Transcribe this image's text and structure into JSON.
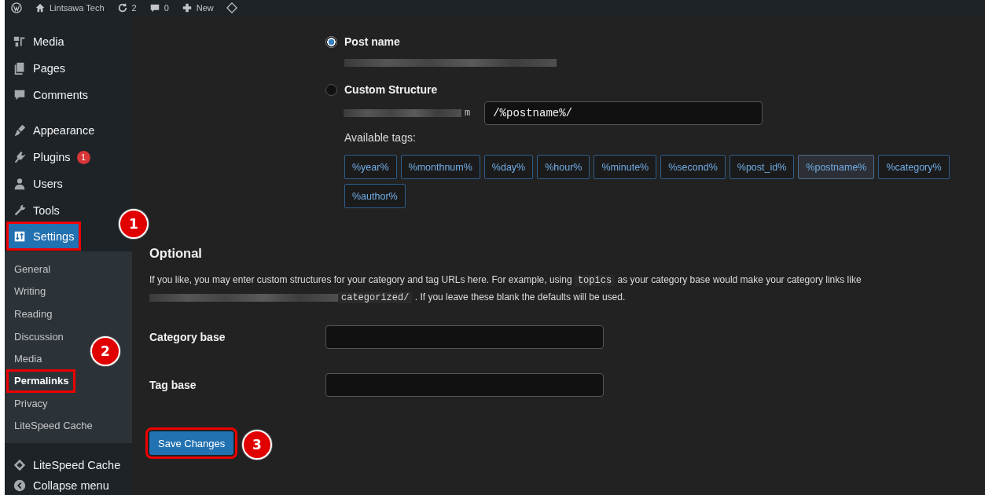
{
  "admin_bar": {
    "site": "Lintsawa Tech",
    "updates": "2",
    "comments": "0",
    "new": "New"
  },
  "sidebar": {
    "groups": [
      {
        "items": [
          {
            "label": "Media",
            "selected": false
          },
          {
            "label": "Pages",
            "selected": false
          },
          {
            "label": "Comments",
            "selected": false
          }
        ]
      },
      {
        "items": [
          {
            "label": "Appearance",
            "selected": false
          },
          {
            "label": "Plugins",
            "selected": false,
            "badge": "1"
          },
          {
            "label": "Users",
            "selected": false
          },
          {
            "label": "Tools",
            "selected": false
          },
          {
            "label": "Settings",
            "selected": true,
            "highlighted": true,
            "callout": "1"
          }
        ]
      }
    ],
    "submenu": [
      {
        "label": "General",
        "selected": false
      },
      {
        "label": "Writing",
        "selected": false
      },
      {
        "label": "Reading",
        "selected": false
      },
      {
        "label": "Discussion",
        "selected": false
      },
      {
        "label": "Media",
        "selected": false
      },
      {
        "label": "Permalinks",
        "selected": true,
        "highlighted": true,
        "callout": "2"
      },
      {
        "label": "Privacy",
        "selected": false
      },
      {
        "label": "LiteSpeed Cache",
        "selected": false
      }
    ],
    "plugin_item": "LiteSpeed Cache",
    "collapse": "Collapse menu"
  },
  "permalinks": {
    "options": [
      {
        "label": "Post name",
        "selected": true
      },
      {
        "label": "Custom Structure",
        "selected": false
      }
    ],
    "custom_suffix": "m",
    "custom_value": "/%postname%/",
    "tags_label": "Available tags:",
    "tags": [
      {
        "label": "%year%",
        "selected": false
      },
      {
        "label": "%monthnum%",
        "selected": false
      },
      {
        "label": "%day%",
        "selected": false
      },
      {
        "label": "%hour%",
        "selected": false
      },
      {
        "label": "%minute%",
        "selected": false
      },
      {
        "label": "%second%",
        "selected": false
      },
      {
        "label": "%post_id%",
        "selected": false
      },
      {
        "label": "%postname%",
        "selected": true
      },
      {
        "label": "%category%",
        "selected": false
      },
      {
        "label": "%author%",
        "selected": false
      }
    ]
  },
  "optional": {
    "title": "Optional",
    "text_1": "If you like, you may enter custom structures for your category and tag URLs here. For example, using",
    "code_1": "topics",
    "text_2": "as your category base would make your category links like",
    "code_2": "categorized/",
    "text_3": ". If you leave these blank the defaults will be used.",
    "fields": [
      {
        "label": "Category base"
      },
      {
        "label": "Tag base"
      }
    ]
  },
  "save": {
    "label": "Save Changes",
    "highlighted": true,
    "callout": "3"
  }
}
